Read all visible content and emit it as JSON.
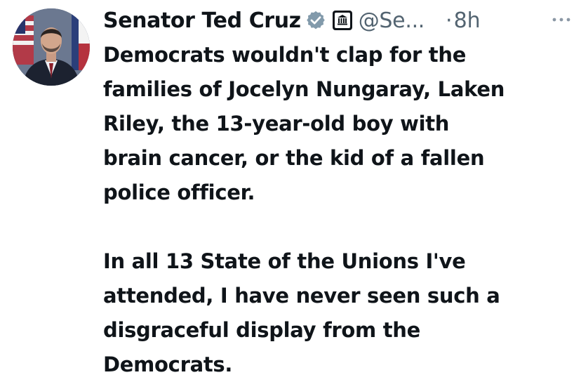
{
  "tweet": {
    "author": {
      "display_name": "Senator Ted Cruz",
      "handle": "@Se...",
      "verified_icon": "verified-badge-icon",
      "affiliation_icon": "government-building-icon"
    },
    "separator": "·",
    "time": "8h",
    "more_icon": "more-options-icon",
    "paragraphs": [
      "Democrats wouldn't clap for the\nfamilies of Jocelyn Nungaray, Laken\nRiley, the 13-year-old boy with\nbrain cancer, or the kid of a fallen\npolice officer.",
      "In all 13 State of the Unions I've\nattended, I have never seen such a\ndisgraceful display from the\nDemocrats."
    ]
  },
  "colors": {
    "text_primary": "#0f1419",
    "text_secondary": "#536471",
    "verified_gray": "#829aab"
  }
}
